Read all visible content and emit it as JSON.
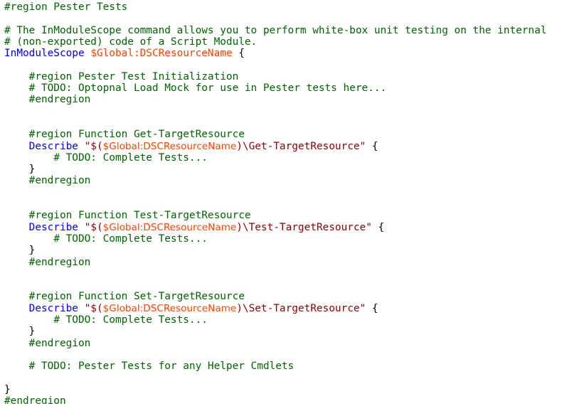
{
  "editor": {
    "colors": {
      "comment": "#006400",
      "keyword": "#0000ff",
      "variable": "#ff4500",
      "string": "#8b0000",
      "default": "#000000",
      "background": "#ffffff"
    },
    "lines": [
      [
        {
          "t": "comment",
          "v": "#region Pester Tests"
        }
      ],
      [],
      [
        {
          "t": "comment",
          "v": "# The InModuleScope command allows you to perform white-box unit testing on the internal"
        }
      ],
      [
        {
          "t": "comment",
          "v": "# (non-exported) code of a Script Module."
        }
      ],
      [
        {
          "t": "keyword",
          "v": "InModuleScope"
        },
        {
          "t": "default",
          "v": " "
        },
        {
          "t": "variable",
          "v": "$Global:DSCResourceName"
        },
        {
          "t": "default",
          "v": " {"
        }
      ],
      [],
      [
        {
          "t": "default",
          "v": "    "
        },
        {
          "t": "comment",
          "v": "#region Pester Test Initialization"
        }
      ],
      [
        {
          "t": "default",
          "v": "    "
        },
        {
          "t": "comment",
          "v": "# TODO: Optopnal Load Mock for use in Pester tests here..."
        }
      ],
      [
        {
          "t": "default",
          "v": "    "
        },
        {
          "t": "comment",
          "v": "#endregion"
        }
      ],
      [],
      [],
      [
        {
          "t": "default",
          "v": "    "
        },
        {
          "t": "comment",
          "v": "#region Function Get-TargetResource"
        }
      ],
      [
        {
          "t": "default",
          "v": "    "
        },
        {
          "t": "keyword",
          "v": "Describe"
        },
        {
          "t": "default",
          "v": " "
        },
        {
          "t": "string",
          "v": "\"$("
        },
        {
          "t": "varinner",
          "v": "$Global:DSCResourceName"
        },
        {
          "t": "string",
          "v": ")\\Get-TargetResource\""
        },
        {
          "t": "default",
          "v": " {"
        }
      ],
      [
        {
          "t": "default",
          "v": "        "
        },
        {
          "t": "comment",
          "v": "# TODO: Complete Tests..."
        }
      ],
      [
        {
          "t": "default",
          "v": "    }"
        }
      ],
      [
        {
          "t": "default",
          "v": "    "
        },
        {
          "t": "comment",
          "v": "#endregion"
        }
      ],
      [],
      [],
      [
        {
          "t": "default",
          "v": "    "
        },
        {
          "t": "comment",
          "v": "#region Function Test-TargetResource"
        }
      ],
      [
        {
          "t": "default",
          "v": "    "
        },
        {
          "t": "keyword",
          "v": "Describe"
        },
        {
          "t": "default",
          "v": " "
        },
        {
          "t": "string",
          "v": "\"$("
        },
        {
          "t": "varinner",
          "v": "$Global:DSCResourceName"
        },
        {
          "t": "string",
          "v": ")\\Test-TargetResource\""
        },
        {
          "t": "default",
          "v": " {"
        }
      ],
      [
        {
          "t": "default",
          "v": "        "
        },
        {
          "t": "comment",
          "v": "# TODO: Complete Tests..."
        }
      ],
      [
        {
          "t": "default",
          "v": "    }"
        }
      ],
      [
        {
          "t": "default",
          "v": "    "
        },
        {
          "t": "comment",
          "v": "#endregion"
        }
      ],
      [],
      [],
      [
        {
          "t": "default",
          "v": "    "
        },
        {
          "t": "comment",
          "v": "#region Function Set-TargetResource"
        }
      ],
      [
        {
          "t": "default",
          "v": "    "
        },
        {
          "t": "keyword",
          "v": "Describe"
        },
        {
          "t": "default",
          "v": " "
        },
        {
          "t": "string",
          "v": "\"$("
        },
        {
          "t": "varinner",
          "v": "$Global:DSCResourceName"
        },
        {
          "t": "string",
          "v": ")\\Set-TargetResource\""
        },
        {
          "t": "default",
          "v": " {"
        }
      ],
      [
        {
          "t": "default",
          "v": "        "
        },
        {
          "t": "comment",
          "v": "# TODO: Complete Tests..."
        }
      ],
      [
        {
          "t": "default",
          "v": "    }"
        }
      ],
      [
        {
          "t": "default",
          "v": "    "
        },
        {
          "t": "comment",
          "v": "#endregion"
        }
      ],
      [],
      [
        {
          "t": "default",
          "v": "    "
        },
        {
          "t": "comment",
          "v": "# TODO: Pester Tests for any Helper Cmdlets"
        }
      ],
      [],
      [
        {
          "t": "default",
          "v": "}"
        }
      ],
      [
        {
          "t": "comment",
          "v": "#endregion"
        }
      ]
    ]
  }
}
